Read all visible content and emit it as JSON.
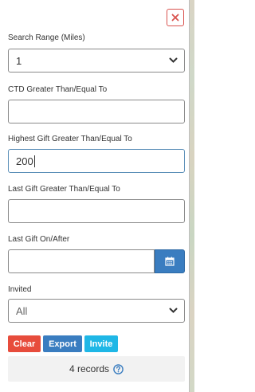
{
  "filters": {
    "search_range": {
      "label": "Search Range (Miles)",
      "value": "1"
    },
    "ctd": {
      "label": "CTD Greater Than/Equal To",
      "value": ""
    },
    "highest_gift": {
      "label": "Highest Gift Greater Than/Equal To",
      "value": "200"
    },
    "last_gift_amount": {
      "label": "Last Gift Greater Than/Equal To",
      "value": ""
    },
    "last_gift_date": {
      "label": "Last Gift On/After",
      "value": ""
    },
    "invited": {
      "label": "Invited",
      "value": "All"
    }
  },
  "actions": {
    "clear_label": "Clear",
    "export_label": "Export",
    "invite_label": "Invite"
  },
  "summary": {
    "records_text": "4 records"
  },
  "icons": {
    "close": "close-icon",
    "calendar": "calendar-icon",
    "help": "question-circle-icon",
    "dropdown": "chevron-down-icon"
  },
  "colors": {
    "close_red": "#d9534f",
    "clear_red": "#e74c3c",
    "export_blue": "#3a7dc0",
    "invite_cyan": "#1fb7e6",
    "calendar_blue": "#3a7dc0"
  }
}
